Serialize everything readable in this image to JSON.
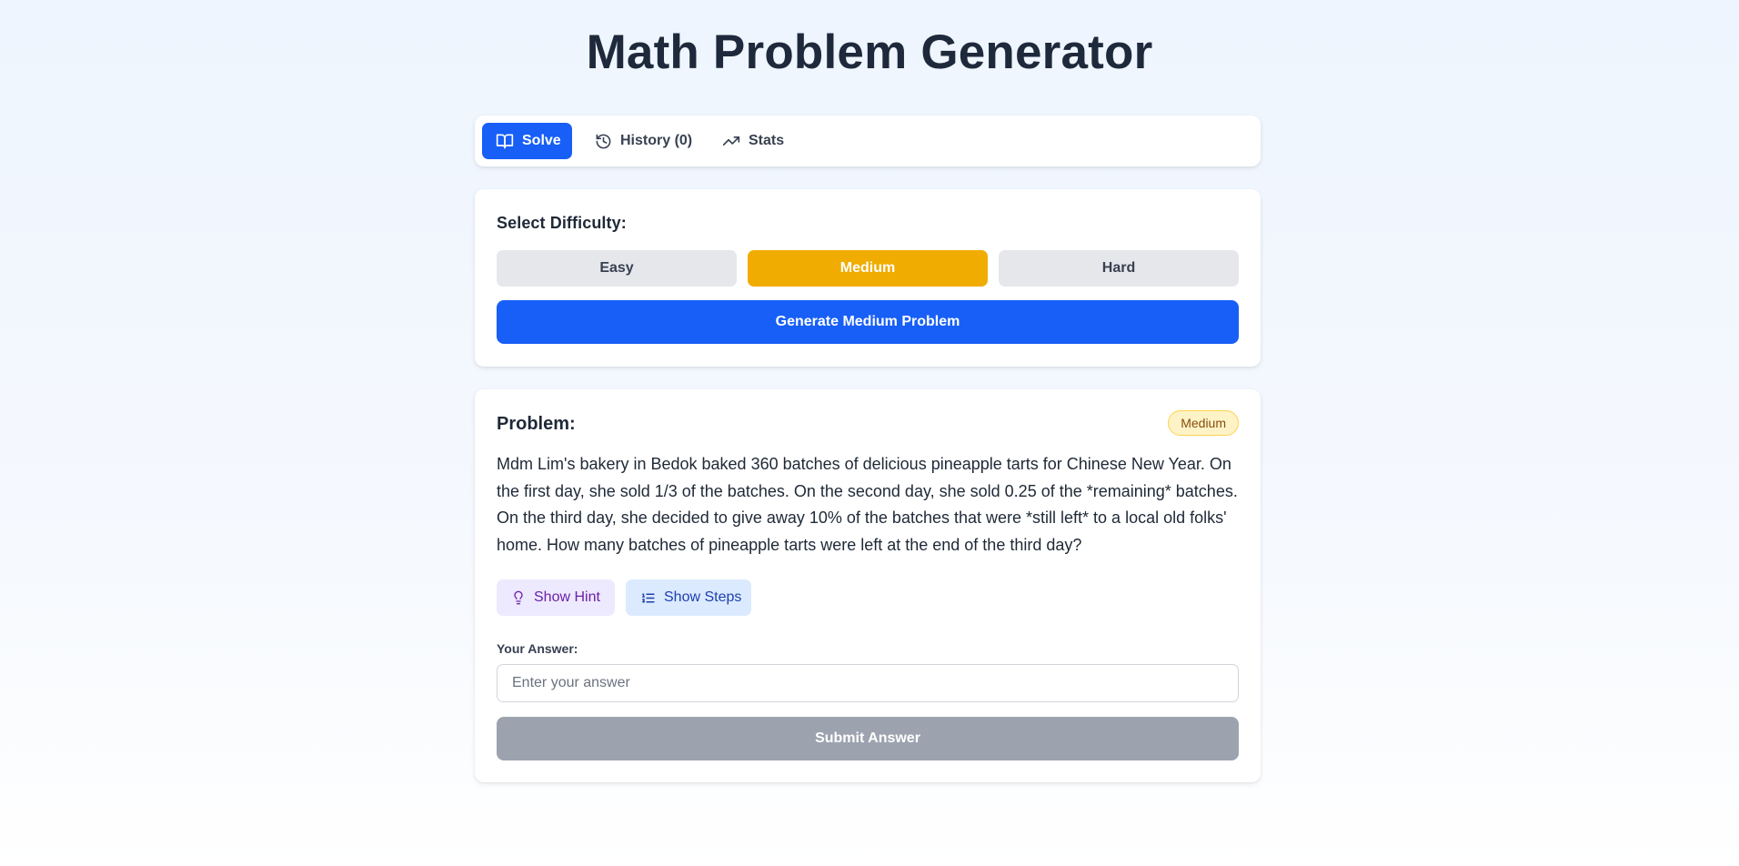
{
  "app": {
    "title": "Math Problem Generator"
  },
  "tabs": [
    {
      "label": "Solve",
      "icon": "book-open-icon",
      "active": true
    },
    {
      "label": "History (0)",
      "icon": "history-icon",
      "active": false
    },
    {
      "label": "Stats",
      "icon": "trending-up-icon",
      "active": false
    }
  ],
  "difficulty": {
    "label": "Select Difficulty:",
    "options": [
      "Easy",
      "Medium",
      "Hard"
    ],
    "selected": "Medium",
    "generate_label": "Generate Medium Problem"
  },
  "problem": {
    "label": "Problem:",
    "badge": "Medium",
    "text": "Mdm Lim's bakery in Bedok baked 360 batches of delicious pineapple tarts for Chinese New Year. On the first day, she sold 1/3 of the batches. On the second day, she sold 0.25 of the *remaining* batches. On the third day, she decided to give away 10% of the batches that were *still left* to a local old folks' home. How many batches of pineapple tarts were left at the end of the third day?",
    "hint_label": "Show Hint",
    "steps_label": "Show Steps"
  },
  "answer": {
    "label": "Your Answer:",
    "placeholder": "Enter your answer",
    "value": "",
    "submit_label": "Submit Answer"
  },
  "colors": {
    "primary": "#175ff7",
    "medium_selected": "#f0ac00",
    "unselected": "#e5e7eb",
    "submit_disabled": "#9ca3af",
    "badge_bg": "#fef3c7"
  }
}
